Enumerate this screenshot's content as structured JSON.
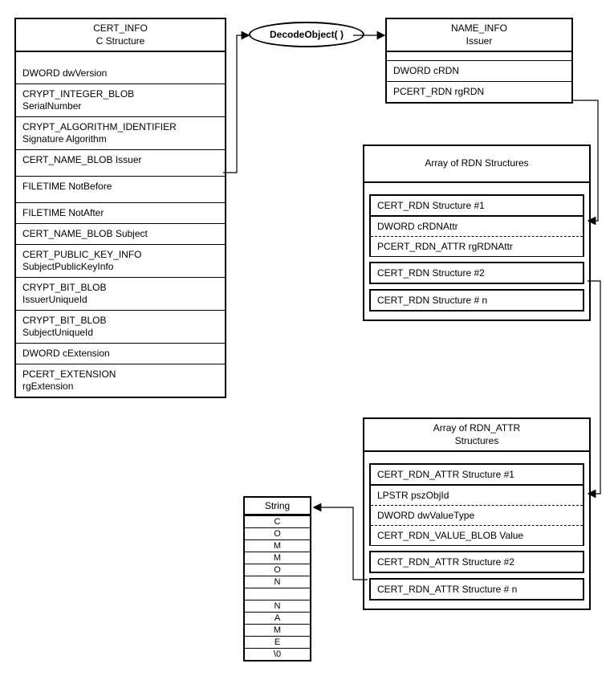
{
  "cert_info": {
    "title1": "CERT_INFO",
    "title2": "C Structure",
    "rows": [
      "DWORD dwVersion",
      "CRYPT_INTEGER_BLOB SerialNumber",
      "CRYPT_ALGORITHM_IDENTIFIER Signature Algorithm",
      "CERT_NAME_BLOB Issuer",
      "FILETIME NotBefore",
      "FILETIME NotAfter",
      "CERT_NAME_BLOB Subject",
      "CERT_PUBLIC_KEY_INFO SubjectPublicKeyInfo",
      "CRYPT_BIT_BLOB IssuerUniqueId",
      "CRYPT_BIT_BLOB SubjectUniqueId",
      "DWORD cExtension",
      "PCERT_EXTENSION rgExtension"
    ]
  },
  "decode_label": "DecodeObject( )",
  "name_info": {
    "title1": "NAME_INFO",
    "title2": "Issuer",
    "rows": [
      "DWORD  cRDN",
      "PCERT_RDN     rgRDN"
    ]
  },
  "rdn_array": {
    "title": "Array of RDN  Structures",
    "s1": "CERT_RDN Structure #1",
    "d1": "DWORD  cRDNAttr",
    "d2": "PCERT_RDN_ATTR  rgRDNAttr",
    "s2": "CERT_RDN Structure #2",
    "s3": "CERT_RDN Structure # n"
  },
  "rdn_attr_array": {
    "title1": "Array of RDN_ATTR",
    "title2": "Structures",
    "s1": "CERT_RDN_ATTR Structure #1",
    "d1": "LPSTR pszObjId",
    "d2": "DWORD dwValueType",
    "d3": "CERT_RDN_VALUE_BLOB Value",
    "s2": "CERT_RDN_ATTR Structure #2",
    "s3": "CERT_RDN_ATTR Structure # n"
  },
  "string_box": {
    "title": "String",
    "chars": [
      "C",
      "O",
      "M",
      "M",
      "O",
      "N",
      "",
      "N",
      "A",
      "M",
      "E",
      "\\0"
    ]
  }
}
